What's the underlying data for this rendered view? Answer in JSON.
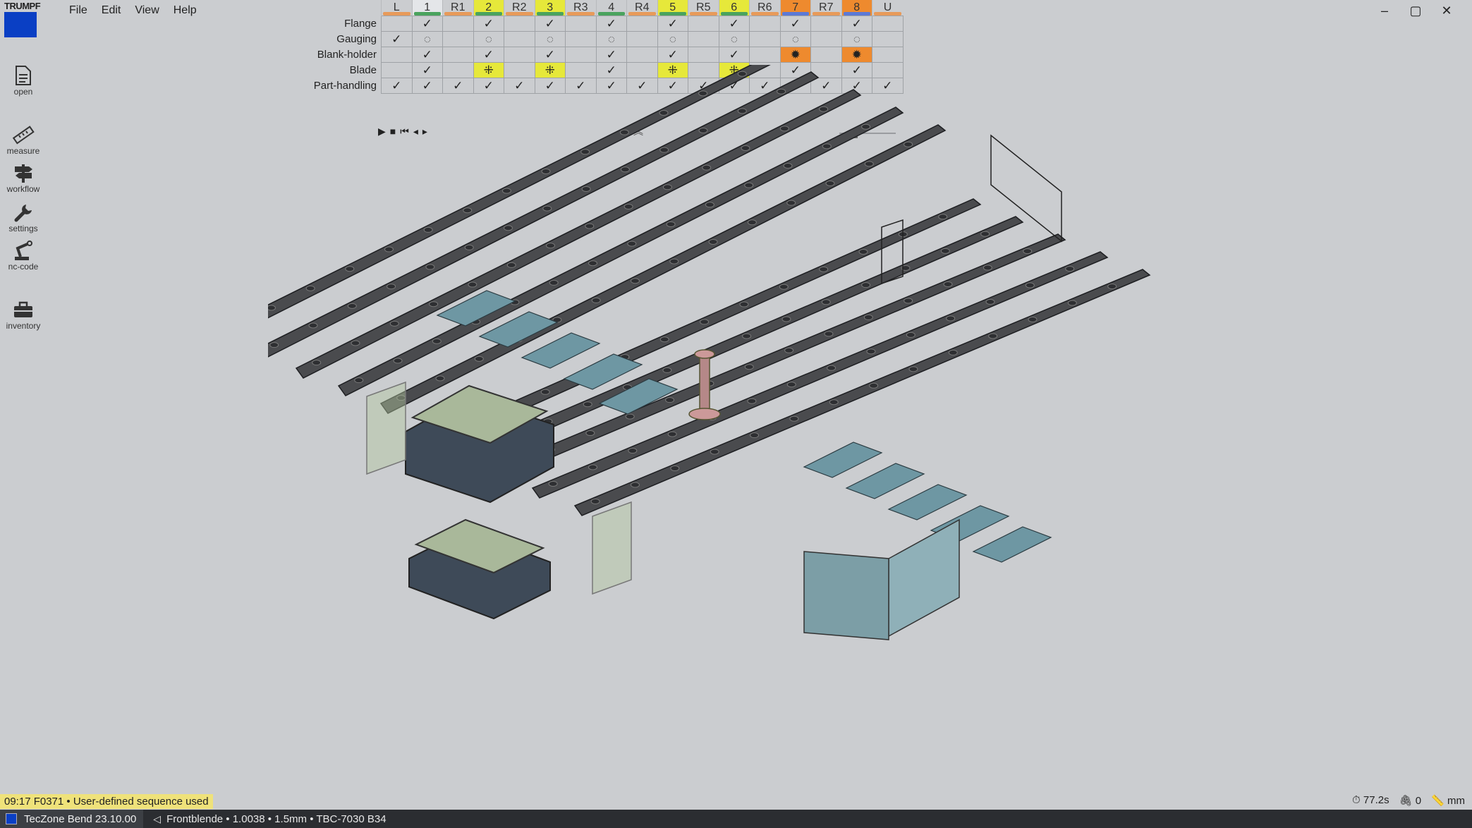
{
  "brand": {
    "name": "TRUMPF"
  },
  "menu": [
    "File",
    "Edit",
    "View",
    "Help"
  ],
  "window": {
    "minimize": "–",
    "maximize": "▢",
    "close": "✕"
  },
  "sidebar": [
    {
      "label": "open",
      "icon": "document-icon"
    },
    {
      "label": "measure",
      "icon": "ruler-icon"
    },
    {
      "label": "workflow",
      "icon": "signpost-icon"
    },
    {
      "label": "settings",
      "icon": "wrench-icon"
    },
    {
      "label": "nc-code",
      "icon": "robot-arm-icon"
    },
    {
      "label": "inventory",
      "icon": "toolbox-icon"
    }
  ],
  "grid": {
    "columns": [
      {
        "label": "L",
        "bar": "#e79a5a",
        "bg": ""
      },
      {
        "label": "1",
        "bar": "#4aa35e",
        "bg": "#e4e6e9"
      },
      {
        "label": "R1",
        "bar": "#e79a5a",
        "bg": ""
      },
      {
        "label": "2",
        "bar": "#4aa35e",
        "bg": "#e6e83a"
      },
      {
        "label": "R2",
        "bar": "#e79a5a",
        "bg": ""
      },
      {
        "label": "3",
        "bar": "#4aa35e",
        "bg": "#e6e83a"
      },
      {
        "label": "R3",
        "bar": "#e79a5a",
        "bg": ""
      },
      {
        "label": "4",
        "bar": "#4aa35e",
        "bg": ""
      },
      {
        "label": "R4",
        "bar": "#e79a5a",
        "bg": ""
      },
      {
        "label": "5",
        "bar": "#4aa35e",
        "bg": "#e6e83a"
      },
      {
        "label": "R5",
        "bar": "#e79a5a",
        "bg": ""
      },
      {
        "label": "6",
        "bar": "#4aa35e",
        "bg": "#e6e83a"
      },
      {
        "label": "R6",
        "bar": "#e79a5a",
        "bg": ""
      },
      {
        "label": "7",
        "bar": "#5b79d6",
        "bg": "#ee8a2e"
      },
      {
        "label": "R7",
        "bar": "#e79a5a",
        "bg": ""
      },
      {
        "label": "8",
        "bar": "#5b79d6",
        "bg": "#ee8a2e"
      },
      {
        "label": "U",
        "bar": "#e79a5a",
        "bg": ""
      }
    ],
    "rows": [
      {
        "label": "Flange",
        "cells": [
          "",
          "check",
          "",
          "check",
          "",
          "check",
          "",
          "check",
          "",
          "check",
          "",
          "check",
          "",
          "check",
          "",
          "check",
          ""
        ]
      },
      {
        "label": "Gauging",
        "cells": [
          "check",
          "dot",
          "",
          "dot",
          "",
          "dot",
          "",
          "dot",
          "",
          "dot",
          "",
          "dot",
          "",
          "dot",
          "",
          "dot",
          ""
        ]
      },
      {
        "label": "Blank-holder",
        "cells": [
          "",
          "check",
          "",
          "check",
          "",
          "check",
          "",
          "check",
          "",
          "check",
          "",
          "check",
          "",
          "warn",
          "",
          "warn",
          ""
        ]
      },
      {
        "label": "Blade",
        "cells": [
          "",
          "check",
          "",
          "blade",
          "",
          "blade",
          "",
          "check",
          "",
          "blade",
          "",
          "blade",
          "",
          "check",
          "",
          "check",
          ""
        ]
      },
      {
        "label": "Part-handling",
        "cells": [
          "check",
          "check",
          "check",
          "check",
          "check",
          "check",
          "check",
          "check",
          "check",
          "check",
          "check",
          "check",
          "check",
          "check",
          "check",
          "check",
          "check"
        ]
      }
    ],
    "symbols": {
      "check": "✓",
      "dot": "◌",
      "warn": "✹",
      "blade": "⁜",
      "": ""
    },
    "cell_colors": {
      "warn": "#ee8a2e",
      "blade": "#e6e83a"
    }
  },
  "playback": [
    "▶",
    "■",
    "⏮",
    "◂",
    "▸"
  ],
  "collapse_symbol": "︽",
  "message": "09:17  F0371 • User-defined sequence used",
  "status": {
    "time": "⏱ 77.2s",
    "attachments": "🖇 0",
    "unit": "📏 mm"
  },
  "taskbar": {
    "app": "TecZone Bend 23.10.00",
    "doc": "Frontblende • 1.0038 • 1.5mm • TBC-7030 B34"
  }
}
